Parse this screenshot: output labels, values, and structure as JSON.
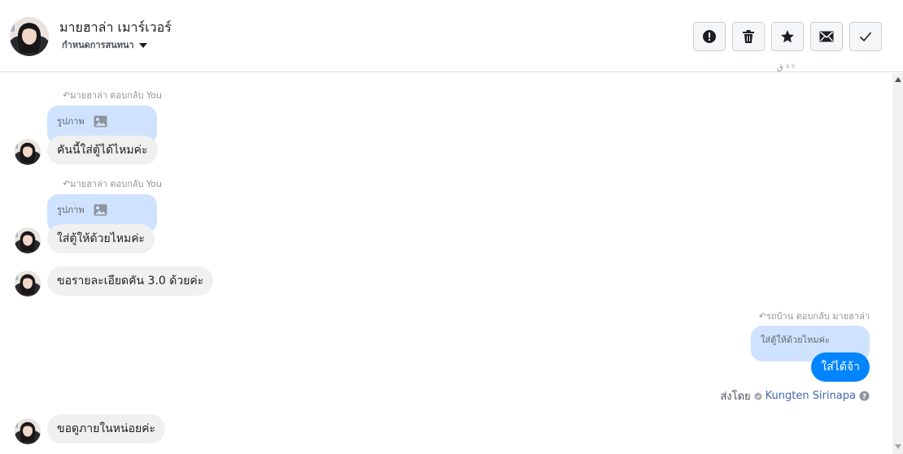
{
  "header": {
    "contact_name": "มายฮาล่า เมาร์เวอร์",
    "conversation_label": "กำหนดการสนทนา",
    "actions": [
      {
        "name": "report-button",
        "icon": "exclamation-circle-icon"
      },
      {
        "name": "delete-button",
        "icon": "trash-icon"
      },
      {
        "name": "star-button",
        "icon": "star-icon"
      },
      {
        "name": "mark-unread-button",
        "icon": "envelope-icon"
      },
      {
        "name": "mark-done-button",
        "icon": "check-icon"
      }
    ]
  },
  "messages": {
    "m1": {
      "reply_meta": "มายฮาล่า ตอบกลับ You",
      "preview": "รูปภาพ",
      "text": "คันนี้ใส่ตู้ได้ไหมค่ะ"
    },
    "m2": {
      "reply_meta": "มายฮาล่า ตอบกลับ You",
      "preview": "รูปภาพ",
      "text": "ใส่ตู้ให้ด้วยไหมค่ะ"
    },
    "m3": {
      "text": "ขอรายละเอียดคัน 3.0 ด้วยค่ะ"
    },
    "m4": {
      "reply_meta": "รถบ้าน ตอบกลับ มายฮาล่า",
      "preview": "ใส่ตู้ให้ด้วยไหมค่ะ",
      "text": "ใส่ได้จ้า"
    },
    "sent_by_label": "ส่งโดย",
    "sent_by_name": "Kungten Sirinapa",
    "m5": {
      "text": "ขอดูภายในหน่อยค่ะ"
    }
  },
  "colors": {
    "outgoing_bubble": "#0084ff",
    "incoming_bubble": "#f1f0f0",
    "reply_preview": "#cfe3ff",
    "link": "#4267b2"
  }
}
